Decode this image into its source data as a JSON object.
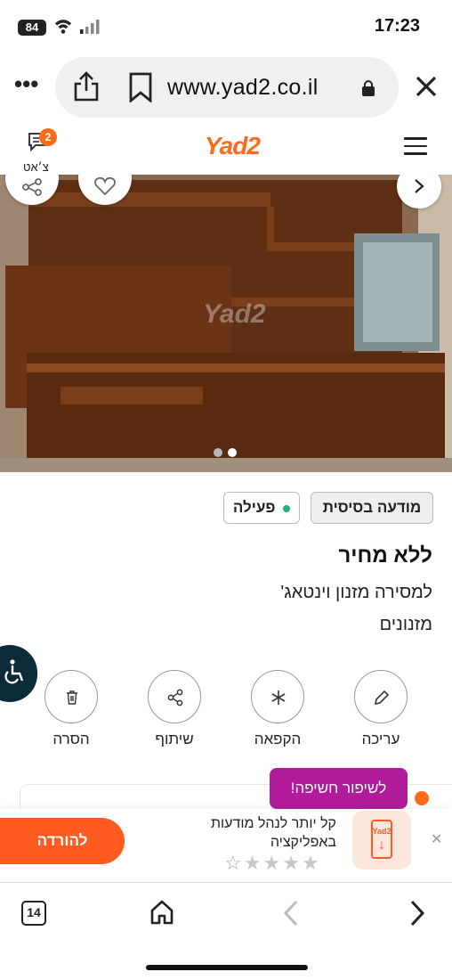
{
  "status_bar": {
    "battery": "84",
    "time": "17:23"
  },
  "browser": {
    "url": "www.yad2.co.il",
    "tab_count": "14",
    "icons": [
      "more-icon",
      "share-icon",
      "bookmark-icon",
      "lock-icon",
      "close-icon",
      "home-icon",
      "back-icon",
      "forward-icon",
      "tabs-icon"
    ]
  },
  "header": {
    "chat_label": "צ׳אט",
    "chat_badge": "2",
    "logo": "Yad2"
  },
  "gallery": {
    "watermark": "Yad2",
    "total_images": 2,
    "current_image": 2
  },
  "listing": {
    "tag_basic": "מודעה בסיסית",
    "tag_status": "פעילה",
    "price": "ללא מחיר",
    "title": "למסירה מזנון וינטאג'",
    "category": "מזנונים"
  },
  "actions": [
    {
      "label": "עריכה",
      "icon": "pencil-icon"
    },
    {
      "label": "הקפאה",
      "icon": "snowflake-icon"
    },
    {
      "label": "שיתוף",
      "icon": "share-nodes-icon"
    },
    {
      "label": "הסרה",
      "icon": "trash-icon"
    }
  ],
  "promo": {
    "improve_label": "לשיפור חשיפה!"
  },
  "app_banner": {
    "text": "קל יותר לנהל מודעות באפליקציה",
    "download_label": "להורדה",
    "rating_stars": 4.5,
    "app_icon_text": "Yad2"
  },
  "colors": {
    "brand_orange": "#ff6b1a",
    "promo_purple": "#b11b9b",
    "status_green": "#27b36b"
  }
}
